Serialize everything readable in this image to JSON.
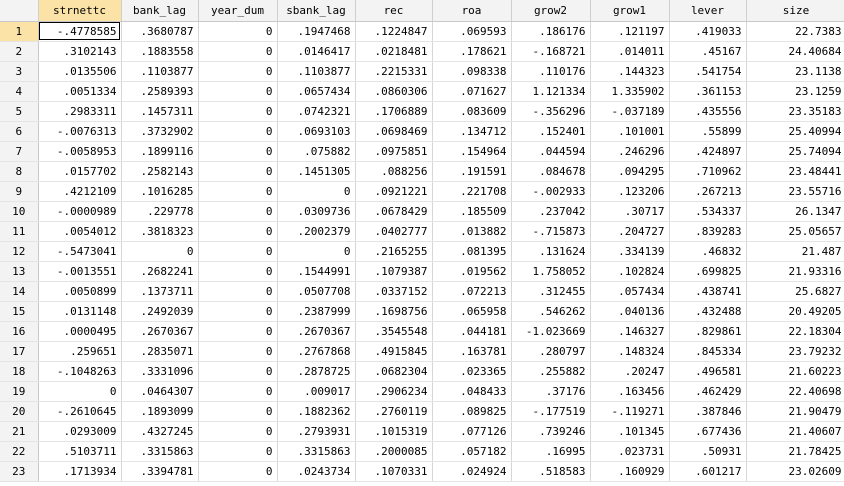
{
  "columns": [
    "strnettc",
    "bank_lag",
    "year_dum",
    "sbank_lag",
    "rec",
    "roa",
    "grow2",
    "grow1",
    "lever",
    "size"
  ],
  "rows": [
    {
      "n": "1",
      "v": [
        "-.4778585",
        ".3680787",
        "0",
        ".1947468",
        ".1224847",
        ".069593",
        ".186176",
        ".121197",
        ".419033",
        "22.7383"
      ]
    },
    {
      "n": "2",
      "v": [
        ".3102143",
        ".1883558",
        "0",
        ".0146417",
        ".0218481",
        ".178621",
        "-.168721",
        ".014011",
        ".45167",
        "24.40684"
      ]
    },
    {
      "n": "3",
      "v": [
        ".0135506",
        ".1103877",
        "0",
        ".1103877",
        ".2215331",
        ".098338",
        ".110176",
        ".144323",
        ".541754",
        "23.1138"
      ]
    },
    {
      "n": "4",
      "v": [
        ".0051334",
        ".2589393",
        "0",
        ".0657434",
        ".0860306",
        ".071627",
        "1.121334",
        "1.335902",
        ".361153",
        "23.1259"
      ]
    },
    {
      "n": "5",
      "v": [
        ".2983311",
        ".1457311",
        "0",
        ".0742321",
        ".1706889",
        ".083609",
        "-.356296",
        "-.037189",
        ".435556",
        "23.35183"
      ]
    },
    {
      "n": "6",
      "v": [
        "-.0076313",
        ".3732902",
        "0",
        ".0693103",
        ".0698469",
        ".134712",
        ".152401",
        ".101001",
        ".55899",
        "25.40994"
      ]
    },
    {
      "n": "7",
      "v": [
        "-.0058953",
        ".1899116",
        "0",
        ".075882",
        ".0975851",
        ".154964",
        ".044594",
        ".246296",
        ".424897",
        "25.74094"
      ]
    },
    {
      "n": "8",
      "v": [
        ".0157702",
        ".2582143",
        "0",
        ".1451305",
        ".088256",
        ".191591",
        ".084678",
        ".094295",
        ".710962",
        "23.48441"
      ]
    },
    {
      "n": "9",
      "v": [
        ".4212109",
        ".1016285",
        "0",
        "0",
        ".0921221",
        ".221708",
        "-.002933",
        ".123206",
        ".267213",
        "23.55716"
      ]
    },
    {
      "n": "10",
      "v": [
        "-.0000989",
        ".229778",
        "0",
        ".0309736",
        ".0678429",
        ".185509",
        ".237042",
        ".30717",
        ".534337",
        "26.1347"
      ]
    },
    {
      "n": "11",
      "v": [
        ".0054012",
        ".3818323",
        "0",
        ".2002379",
        ".0402777",
        ".013882",
        "-.715873",
        ".204727",
        ".839283",
        "25.05657"
      ]
    },
    {
      "n": "12",
      "v": [
        "-.5473041",
        "0",
        "0",
        "0",
        ".2165255",
        ".081395",
        ".131624",
        ".334139",
        ".46832",
        "21.487"
      ]
    },
    {
      "n": "13",
      "v": [
        "-.0013551",
        ".2682241",
        "0",
        ".1544991",
        ".1079387",
        ".019562",
        "1.758052",
        ".102824",
        ".699825",
        "21.93316"
      ]
    },
    {
      "n": "14",
      "v": [
        ".0050899",
        ".1373711",
        "0",
        ".0507708",
        ".0337152",
        ".072213",
        ".312455",
        ".057434",
        ".438741",
        "25.6827"
      ]
    },
    {
      "n": "15",
      "v": [
        ".0131148",
        ".2492039",
        "0",
        ".2387999",
        ".1698756",
        ".065958",
        ".546262",
        ".040136",
        ".432488",
        "20.49205"
      ]
    },
    {
      "n": "16",
      "v": [
        ".0000495",
        ".2670367",
        "0",
        ".2670367",
        ".3545548",
        ".044181",
        "-1.023669",
        ".146327",
        ".829861",
        "22.18304"
      ]
    },
    {
      "n": "17",
      "v": [
        ".259651",
        ".2835071",
        "0",
        ".2767868",
        ".4915845",
        ".163781",
        ".280797",
        ".148324",
        ".845334",
        "23.79232"
      ]
    },
    {
      "n": "18",
      "v": [
        "-.1048263",
        ".3331096",
        "0",
        ".2878725",
        ".0682304",
        ".023365",
        ".255882",
        ".20247",
        ".496581",
        "21.60223"
      ]
    },
    {
      "n": "19",
      "v": [
        "0",
        ".0464307",
        "0",
        ".009017",
        ".2906234",
        ".048433",
        ".37176",
        ".163456",
        ".462429",
        "22.40698"
      ]
    },
    {
      "n": "20",
      "v": [
        "-.2610645",
        ".1893099",
        "0",
        ".1882362",
        ".2760119",
        ".089825",
        "-.177519",
        "-.119271",
        ".387846",
        "21.90479"
      ]
    },
    {
      "n": "21",
      "v": [
        ".0293009",
        ".4327245",
        "0",
        ".2793931",
        ".1015319",
        ".077126",
        ".739246",
        ".101345",
        ".677436",
        "21.40607"
      ]
    },
    {
      "n": "22",
      "v": [
        ".5103711",
        ".3315863",
        "0",
        ".3315863",
        ".2000085",
        ".057182",
        ".16995",
        ".023731",
        ".50931",
        "21.78425"
      ]
    },
    {
      "n": "23",
      "v": [
        ".1713934",
        ".3394781",
        "0",
        ".0243734",
        ".1070331",
        ".024924",
        ".518583",
        ".160929",
        ".601217",
        "23.02609"
      ]
    }
  ],
  "colors": {
    "selection": "#fbe3a8",
    "header": "#f3f3f3"
  }
}
